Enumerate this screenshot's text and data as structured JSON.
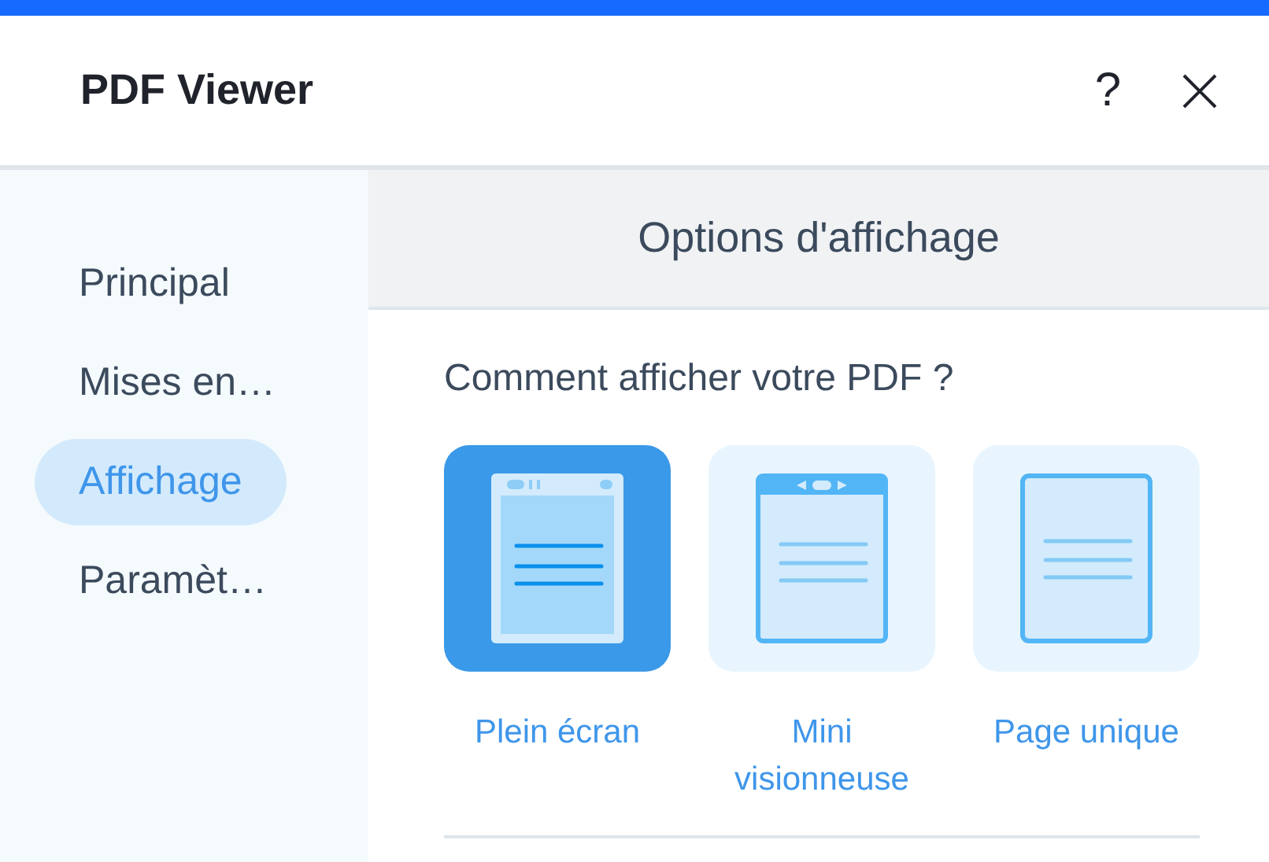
{
  "window": {
    "title": "PDF Viewer",
    "help": "?"
  },
  "sidebar": {
    "items": [
      {
        "label": "Principal",
        "selected": false
      },
      {
        "label": "Mises en…",
        "selected": false
      },
      {
        "label": "Affichage",
        "selected": true
      },
      {
        "label": "Paramèt…",
        "selected": false
      }
    ]
  },
  "section": {
    "title": "Options d'affichage",
    "question": "Comment afficher votre PDF ?",
    "options": [
      {
        "kind": "fullscreen",
        "label": "Plein écran",
        "selected": true
      },
      {
        "kind": "mini",
        "label": "Mini visionneuse",
        "selected": false
      },
      {
        "kind": "single",
        "label": "Page unique",
        "selected": false
      }
    ]
  }
}
